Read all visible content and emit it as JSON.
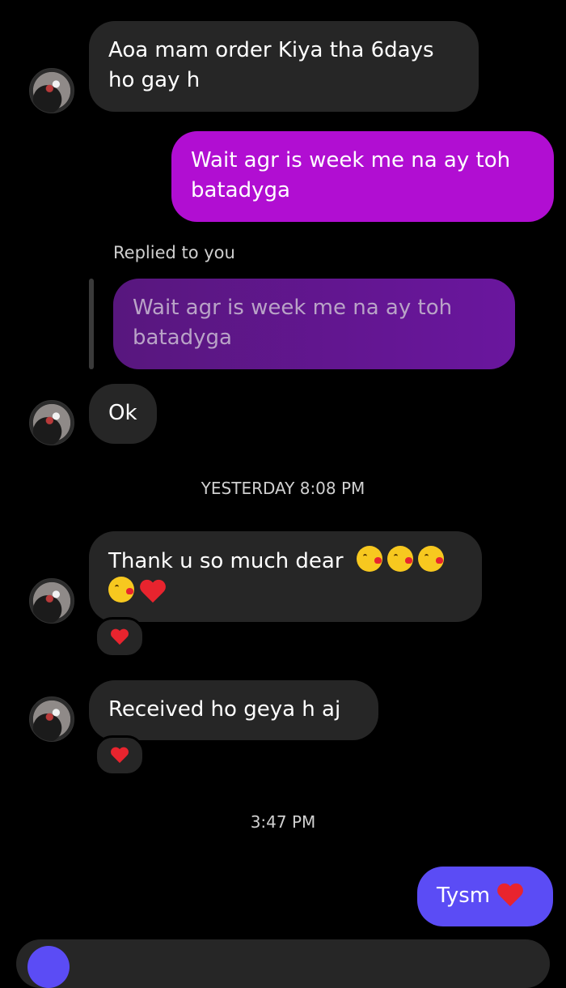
{
  "messages": {
    "m1": {
      "text": "Aoa mam order Kiya tha 6days ho gay h"
    },
    "m2": {
      "text": "Wait agr is week me na ay toh batadyga"
    },
    "reply": {
      "label": "Replied to you",
      "quoted_text": "Wait agr is week me na ay toh batadyga"
    },
    "m3": {
      "text": "Ok"
    },
    "ts1": "YESTERDAY 8:08 PM",
    "m4": {
      "text": "Thank u so much dear",
      "emojis": [
        "kissing-face-emoji",
        "kissing-face-emoji",
        "kissing-face-emoji",
        "kissing-face-emoji",
        "red-heart-emoji"
      ]
    },
    "m5": {
      "text": "Received ho geya h aj"
    },
    "ts2": "3:47 PM",
    "m6": {
      "text": "Tysm"
    }
  },
  "reactions": [
    "red-heart",
    "red-heart"
  ],
  "colors": {
    "background": "#000000",
    "incoming_bubble": "#262626",
    "outgoing_pink": "#b10ed2",
    "outgoing_blue": "#5b4cf5",
    "heart": "#e8242e"
  }
}
